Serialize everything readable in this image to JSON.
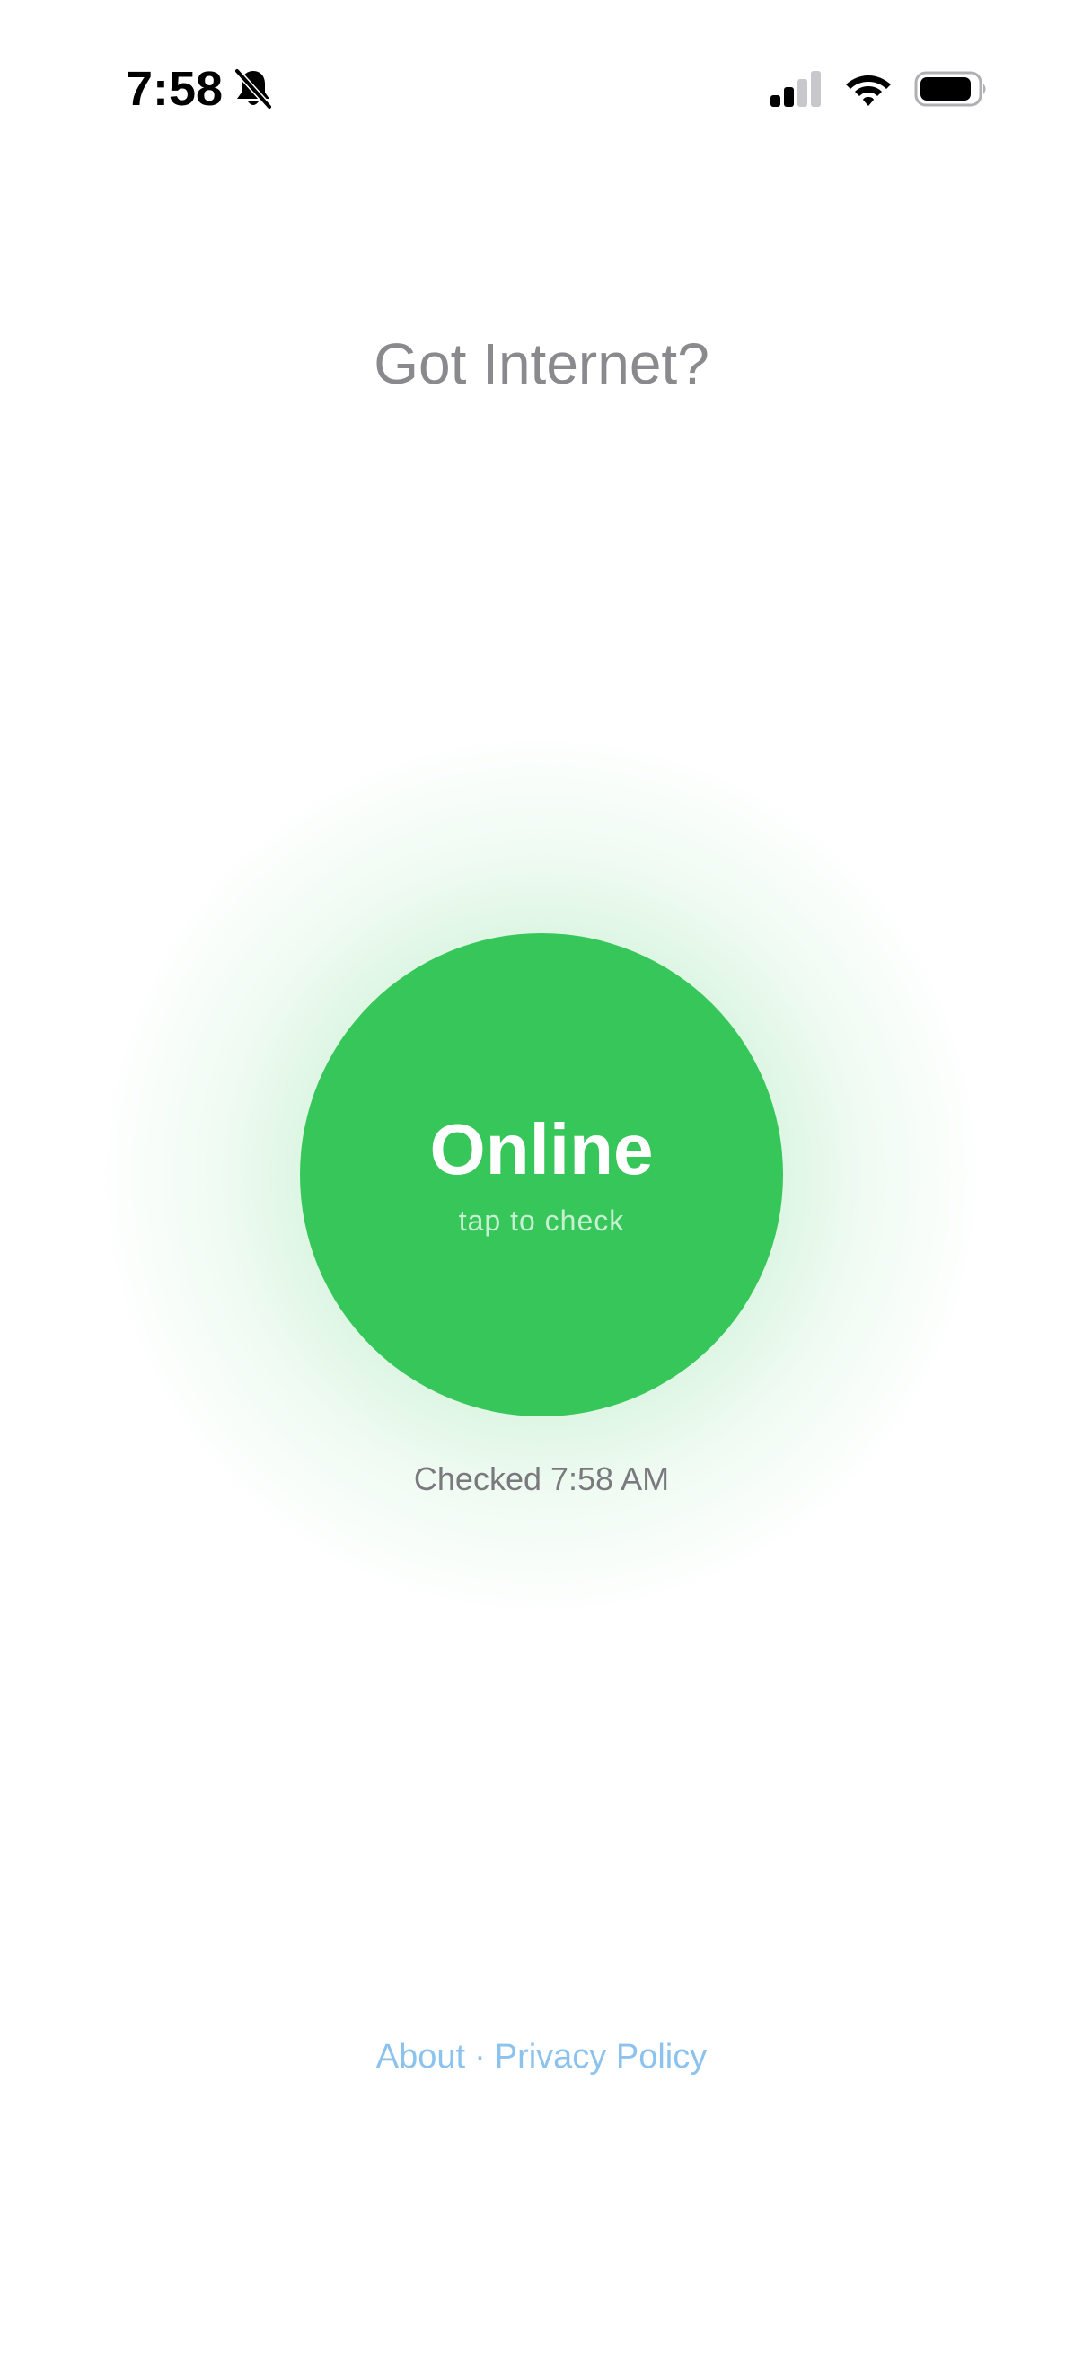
{
  "status_bar": {
    "time": "7:58",
    "icons": [
      "bell-slash-icon",
      "cellular-signal-icon",
      "wifi-icon",
      "battery-icon"
    ]
  },
  "header": {
    "title": "Got Internet?"
  },
  "status": {
    "state_label": "Online",
    "hint": "tap to check",
    "checked_text": "Checked 7:58 AM",
    "accent_color": "#37c65a"
  },
  "footer": {
    "about_label": "About",
    "separator": "·",
    "privacy_label": "Privacy Policy",
    "link_color": "#8cc3ee"
  }
}
